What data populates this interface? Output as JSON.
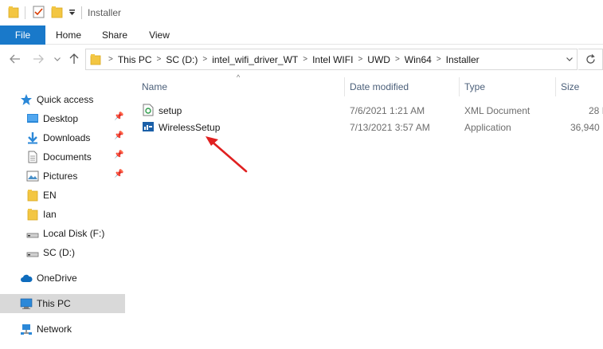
{
  "window": {
    "title": "Installer"
  },
  "ribbon": {
    "tabs": [
      "File",
      "Home",
      "Share",
      "View"
    ]
  },
  "address": {
    "crumbs": [
      "This PC",
      "SC (D:)",
      "intel_wifi_driver_WT",
      "Intel WIFI",
      "UWD",
      "Win64",
      "Installer"
    ]
  },
  "sidebar": {
    "quick_access": "Quick access",
    "items": [
      {
        "label": "Desktop"
      },
      {
        "label": "Downloads"
      },
      {
        "label": "Documents"
      },
      {
        "label": "Pictures"
      },
      {
        "label": "EN"
      },
      {
        "label": "Ian"
      },
      {
        "label": "Local Disk (F:)"
      },
      {
        "label": "SC (D:)"
      }
    ],
    "onedrive": "OneDrive",
    "thispc": "This PC",
    "network": "Network"
  },
  "columns": {
    "name": "Name",
    "date": "Date modified",
    "type": "Type",
    "size": "Size"
  },
  "files": [
    {
      "name": "setup",
      "date": "7/6/2021 1:21 AM",
      "type": "XML Document",
      "size": "28 I"
    },
    {
      "name": "WirelessSetup",
      "date": "7/13/2021 3:57 AM",
      "type": "Application",
      "size": "36,940 I"
    }
  ],
  "colors": {
    "accent": "#1979ca",
    "folder": "#f3c642",
    "selected": "#d9d9d9",
    "arrow": "#e02020",
    "header_text": "#4c607a"
  },
  "icons": {
    "back": "arrow-left-icon",
    "forward": "arrow-right-icon",
    "recent": "chevron-down-icon",
    "up": "arrow-up-icon",
    "refresh": "refresh-icon",
    "pin": "pin-icon"
  }
}
